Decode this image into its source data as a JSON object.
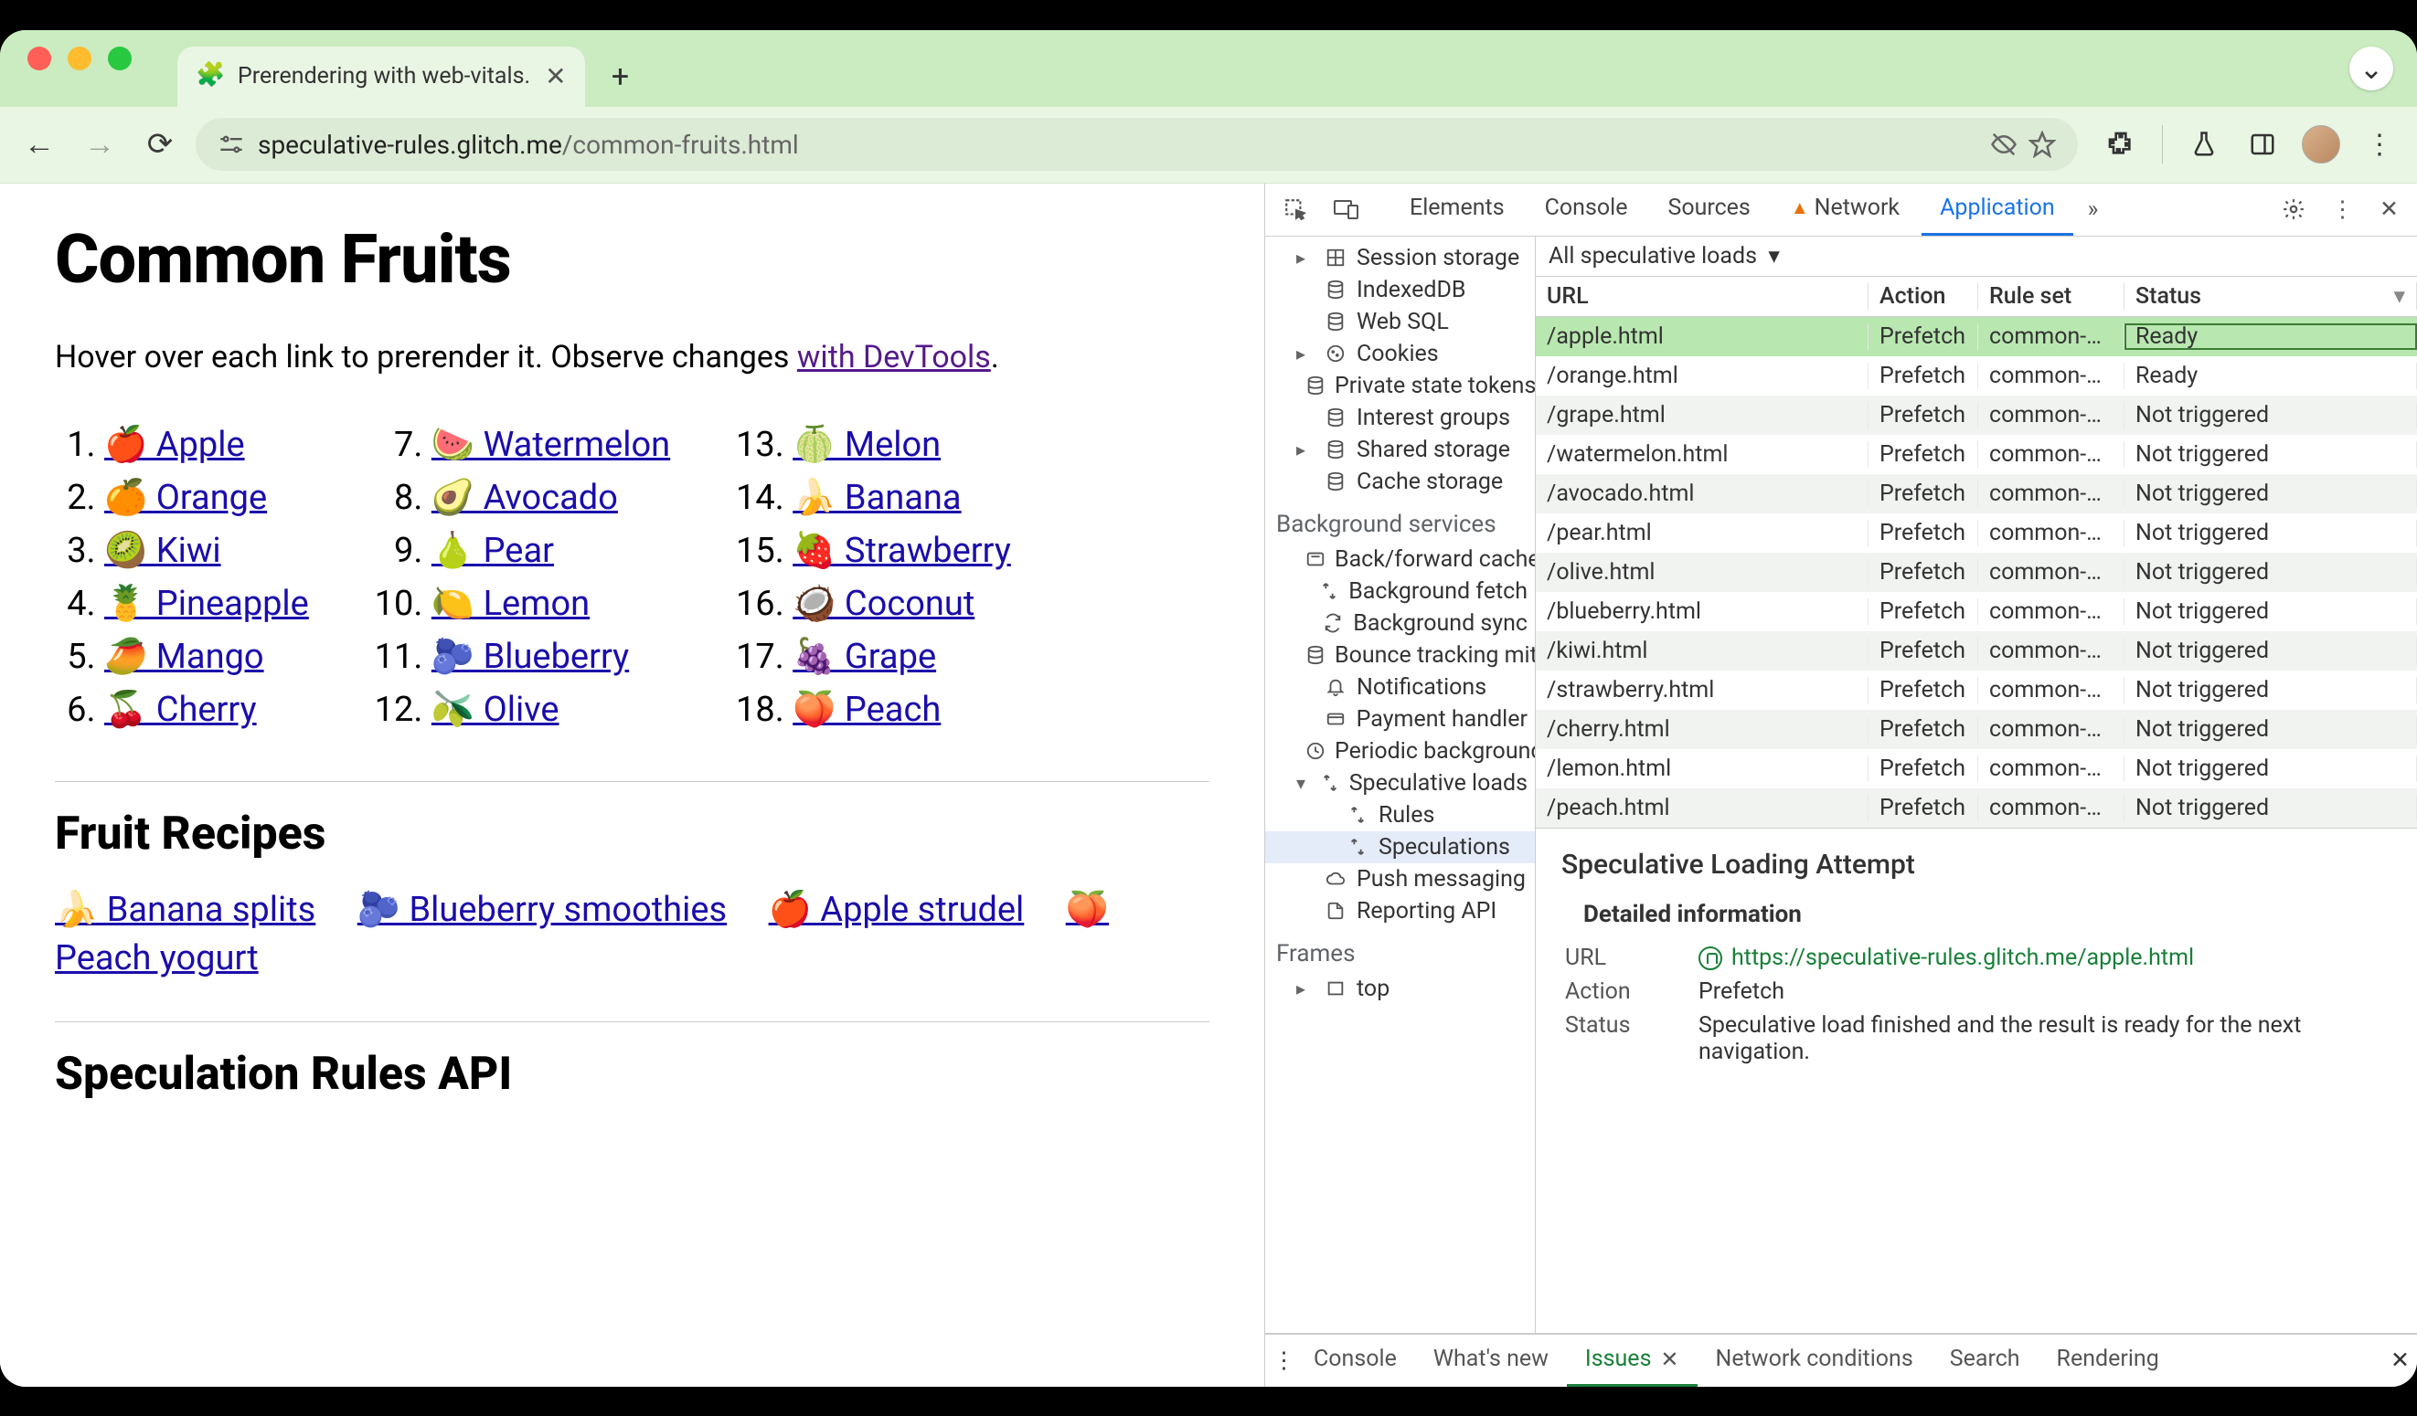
{
  "browser": {
    "tab_title": "Prerendering with web-vitals.",
    "url_host": "speculative-rules.glitch.me",
    "url_path": "/common-fruits.html"
  },
  "page": {
    "h1": "Common Fruits",
    "intro_pre": "Hover over each link to prerender it. Observe changes ",
    "intro_link": "with DevTools",
    "intro_post": ".",
    "fruits": [
      {
        "n": "1",
        "emoji": "🍎",
        "label": "Apple"
      },
      {
        "n": "2",
        "emoji": "🍊",
        "label": "Orange"
      },
      {
        "n": "3",
        "emoji": "🥝",
        "label": "Kiwi"
      },
      {
        "n": "4",
        "emoji": "🍍",
        "label": "Pineapple"
      },
      {
        "n": "5",
        "emoji": "🥭",
        "label": "Mango"
      },
      {
        "n": "6",
        "emoji": "🍒",
        "label": "Cherry"
      },
      {
        "n": "7",
        "emoji": "🍉",
        "label": "Watermelon"
      },
      {
        "n": "8",
        "emoji": "🥑",
        "label": "Avocado"
      },
      {
        "n": "9",
        "emoji": "🍐",
        "label": "Pear"
      },
      {
        "n": "10",
        "emoji": "🍋",
        "label": "Lemon"
      },
      {
        "n": "11",
        "emoji": "🫐",
        "label": "Blueberry"
      },
      {
        "n": "12",
        "emoji": "🫒",
        "label": "Olive"
      },
      {
        "n": "13",
        "emoji": "🍈",
        "label": "Melon"
      },
      {
        "n": "14",
        "emoji": "🍌",
        "label": "Banana"
      },
      {
        "n": "15",
        "emoji": "🍓",
        "label": "Strawberry"
      },
      {
        "n": "16",
        "emoji": "🥥",
        "label": "Coconut"
      },
      {
        "n": "17",
        "emoji": "🍇",
        "label": "Grape"
      },
      {
        "n": "18",
        "emoji": "🍑",
        "label": "Peach"
      }
    ],
    "h2_recipes": "Fruit Recipes",
    "recipes": [
      {
        "emoji": "🍌",
        "label": "Banana splits"
      },
      {
        "emoji": "🫐",
        "label": "Blueberry smoothies"
      },
      {
        "emoji": "🍎",
        "label": "Apple strudel"
      },
      {
        "emoji": "🍑",
        "label": "Peach yogurt"
      }
    ],
    "h2_api": "Speculation Rules API"
  },
  "devtools": {
    "tabs": {
      "elements": "Elements",
      "console": "Console",
      "sources": "Sources",
      "network": "Network",
      "application": "Application"
    },
    "sidebar": {
      "items": [
        {
          "icon": "grid",
          "label": "Session storage",
          "expand": true,
          "lvl": 1
        },
        {
          "icon": "db",
          "label": "IndexedDB",
          "lvl": 1
        },
        {
          "icon": "db",
          "label": "Web SQL",
          "lvl": 1
        },
        {
          "icon": "cookie",
          "label": "Cookies",
          "expand": true,
          "lvl": 1
        },
        {
          "icon": "db",
          "label": "Private state tokens",
          "lvl": 1
        },
        {
          "icon": "db",
          "label": "Interest groups",
          "lvl": 1
        },
        {
          "icon": "db",
          "label": "Shared storage",
          "expand": true,
          "lvl": 1
        },
        {
          "icon": "db",
          "label": "Cache storage",
          "lvl": 1
        }
      ],
      "bg_heading": "Background services",
      "bg_items": [
        {
          "icon": "cache",
          "label": "Back/forward cache"
        },
        {
          "icon": "fetch",
          "label": "Background fetch"
        },
        {
          "icon": "sync",
          "label": "Background sync"
        },
        {
          "icon": "db",
          "label": "Bounce tracking mitigations"
        },
        {
          "icon": "bell",
          "label": "Notifications"
        },
        {
          "icon": "card",
          "label": "Payment handler"
        },
        {
          "icon": "clock",
          "label": "Periodic background sync"
        },
        {
          "icon": "fetch",
          "label": "Speculative loads",
          "expand": true,
          "open": true
        },
        {
          "icon": "fetch",
          "label": "Rules",
          "lvl": 2
        },
        {
          "icon": "fetch",
          "label": "Speculations",
          "lvl": 2,
          "sel": true
        },
        {
          "icon": "cloud",
          "label": "Push messaging"
        },
        {
          "icon": "doc",
          "label": "Reporting API"
        }
      ],
      "frames_heading": "Frames",
      "frames_top": "top"
    },
    "filter_label": "All speculative loads",
    "table": {
      "cols": {
        "url": "URL",
        "action": "Action",
        "ruleset": "Rule set",
        "status": "Status"
      },
      "rows": [
        {
          "url": "/apple.html",
          "action": "Prefetch",
          "ruleset": "common-…",
          "status": "Ready",
          "sel": true
        },
        {
          "url": "/orange.html",
          "action": "Prefetch",
          "ruleset": "common-…",
          "status": "Ready"
        },
        {
          "url": "/grape.html",
          "action": "Prefetch",
          "ruleset": "common-…",
          "status": "Not triggered"
        },
        {
          "url": "/watermelon.html",
          "action": "Prefetch",
          "ruleset": "common-…",
          "status": "Not triggered"
        },
        {
          "url": "/avocado.html",
          "action": "Prefetch",
          "ruleset": "common-…",
          "status": "Not triggered"
        },
        {
          "url": "/pear.html",
          "action": "Prefetch",
          "ruleset": "common-…",
          "status": "Not triggered"
        },
        {
          "url": "/olive.html",
          "action": "Prefetch",
          "ruleset": "common-…",
          "status": "Not triggered"
        },
        {
          "url": "/blueberry.html",
          "action": "Prefetch",
          "ruleset": "common-…",
          "status": "Not triggered"
        },
        {
          "url": "/kiwi.html",
          "action": "Prefetch",
          "ruleset": "common-…",
          "status": "Not triggered"
        },
        {
          "url": "/strawberry.html",
          "action": "Prefetch",
          "ruleset": "common-…",
          "status": "Not triggered"
        },
        {
          "url": "/cherry.html",
          "action": "Prefetch",
          "ruleset": "common-…",
          "status": "Not triggered"
        },
        {
          "url": "/lemon.html",
          "action": "Prefetch",
          "ruleset": "common-…",
          "status": "Not triggered"
        },
        {
          "url": "/peach.html",
          "action": "Prefetch",
          "ruleset": "common-…",
          "status": "Not triggered"
        }
      ]
    },
    "detail": {
      "title": "Speculative Loading Attempt",
      "section": "Detailed information",
      "url_k": "URL",
      "url_v": "https://speculative-rules.glitch.me/apple.html",
      "action_k": "Action",
      "action_v": "Prefetch",
      "status_k": "Status",
      "status_v": "Speculative load finished and the result is ready for the next navigation."
    },
    "drawer": {
      "console": "Console",
      "whatsnew": "What's new",
      "issues": "Issues",
      "netcond": "Network conditions",
      "search": "Search",
      "rendering": "Rendering"
    }
  }
}
